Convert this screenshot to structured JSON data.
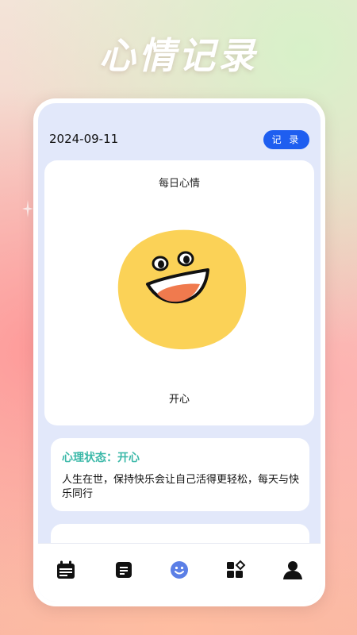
{
  "app_title": "心情记录",
  "header": {
    "date": "2024-09-11",
    "record_button": "记 录"
  },
  "mood_card": {
    "title": "每日心情",
    "emoji_icon": "happy-face-icon",
    "mood": "开心"
  },
  "status_card": {
    "title": "心理状态：开心",
    "text": "人生在世，保持快乐会让自己活得更轻松，每天与快乐同行"
  },
  "bottom_nav": {
    "items": [
      {
        "icon": "calendar-icon",
        "active": false
      },
      {
        "icon": "notes-icon",
        "active": false
      },
      {
        "icon": "smiley-icon",
        "active": true
      },
      {
        "icon": "apps-icon",
        "active": false
      },
      {
        "icon": "profile-icon",
        "active": false
      }
    ],
    "active_color": "#5b7fe6",
    "inactive_color": "#111111"
  },
  "colors": {
    "accent": "#1e5ef0",
    "status_title": "#3ab8a8",
    "emoji_face": "#fbd257"
  }
}
